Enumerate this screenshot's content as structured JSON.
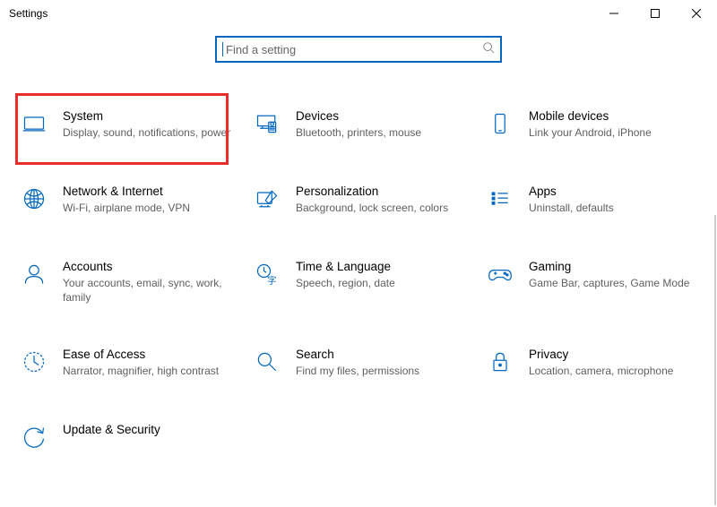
{
  "window": {
    "title": "Settings"
  },
  "search": {
    "placeholder": "Find a setting"
  },
  "categories": [
    {
      "title": "System",
      "desc": "Display, sound, notifications, power"
    },
    {
      "title": "Devices",
      "desc": "Bluetooth, printers, mouse"
    },
    {
      "title": "Mobile devices",
      "desc": "Link your Android, iPhone"
    },
    {
      "title": "Network & Internet",
      "desc": "Wi-Fi, airplane mode, VPN"
    },
    {
      "title": "Personalization",
      "desc": "Background, lock screen, colors"
    },
    {
      "title": "Apps",
      "desc": "Uninstall, defaults"
    },
    {
      "title": "Accounts",
      "desc": "Your accounts, email, sync, work, family"
    },
    {
      "title": "Time & Language",
      "desc": "Speech, region, date"
    },
    {
      "title": "Gaming",
      "desc": "Game Bar, captures, Game Mode"
    },
    {
      "title": "Ease of Access",
      "desc": "Narrator, magnifier, high contrast"
    },
    {
      "title": "Search",
      "desc": "Find my files, permissions"
    },
    {
      "title": "Privacy",
      "desc": "Location, camera, microphone"
    },
    {
      "title": "Update & Security",
      "desc": ""
    }
  ]
}
